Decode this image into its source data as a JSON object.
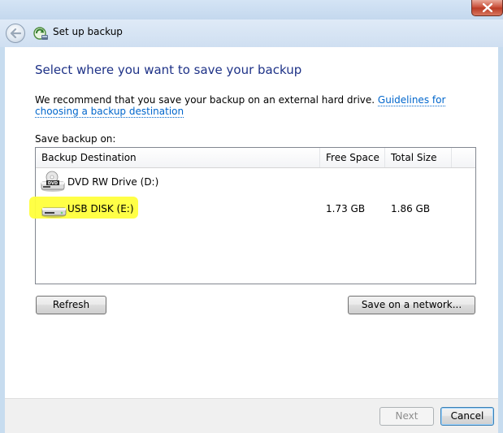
{
  "window": {
    "title": "Set up backup"
  },
  "page": {
    "heading": "Select where you want to save your backup",
    "intro_text": "We recommend that you save your backup on an external hard drive. ",
    "guidelines_link": "Guidelines for choosing a backup destination",
    "save_on_label": "Save backup on:"
  },
  "table": {
    "columns": [
      "Backup Destination",
      "Free Space",
      "Total Size"
    ],
    "rows": [
      {
        "name": "DVD RW Drive (D:)",
        "free": "",
        "total": "",
        "icon": "dvd-drive-icon"
      },
      {
        "name": "USB DISK (E:)",
        "free": "1.73 GB",
        "total": "1.86 GB",
        "icon": "usb-drive-icon",
        "highlighted": true
      }
    ]
  },
  "buttons": {
    "refresh": "Refresh",
    "save_on_network": "Save on a network...",
    "next": "Next",
    "cancel": "Cancel"
  },
  "colors": {
    "heading": "#1e3287",
    "link": "#0066cc",
    "highlight": "#ffff3c",
    "frame": "#c7dcef"
  }
}
